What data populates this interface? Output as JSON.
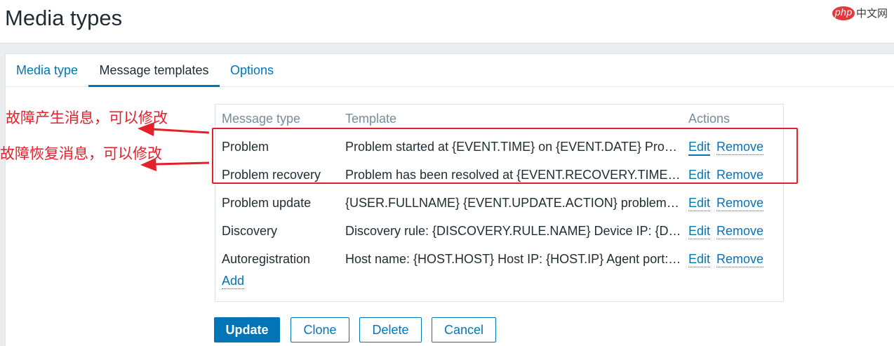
{
  "page": {
    "title": "Media types"
  },
  "watermark": {
    "badge": "php",
    "text": "中文网"
  },
  "tabs": [
    {
      "label": "Media type",
      "active": false
    },
    {
      "label": "Message templates",
      "active": true
    },
    {
      "label": "Options",
      "active": false
    }
  ],
  "table": {
    "headers": {
      "type": "Message type",
      "template": "Template",
      "actions": "Actions"
    },
    "rows": [
      {
        "type": "Problem",
        "template": "Problem started at {EVENT.TIME} on {EVENT.DATE} Pro…",
        "edit": "Edit",
        "remove": "Remove"
      },
      {
        "type": "Problem recovery",
        "template": "Problem has been resolved at {EVENT.RECOVERY.TIME…",
        "edit": "Edit",
        "remove": "Remove"
      },
      {
        "type": "Problem update",
        "template": "{USER.FULLNAME} {EVENT.UPDATE.ACTION} problem …",
        "edit": "Edit",
        "remove": "Remove"
      },
      {
        "type": "Discovery",
        "template": "Discovery rule: {DISCOVERY.RULE.NAME} Device IP: {D…",
        "edit": "Edit",
        "remove": "Remove"
      },
      {
        "type": "Autoregistration",
        "template": "Host name: {HOST.HOST} Host IP: {HOST.IP} Agent port:…",
        "edit": "Edit",
        "remove": "Remove"
      }
    ],
    "add_label": "Add"
  },
  "buttons": {
    "update": "Update",
    "clone": "Clone",
    "delete": "Delete",
    "cancel": "Cancel"
  },
  "annotations": {
    "problem": "故障产生消息，可以修改",
    "recovery": "故障恢复消息，可以修改",
    "color": "#e4202b"
  },
  "colors": {
    "accent": "#0275b8",
    "background": "#ebeef0",
    "muted": "#768d99"
  }
}
